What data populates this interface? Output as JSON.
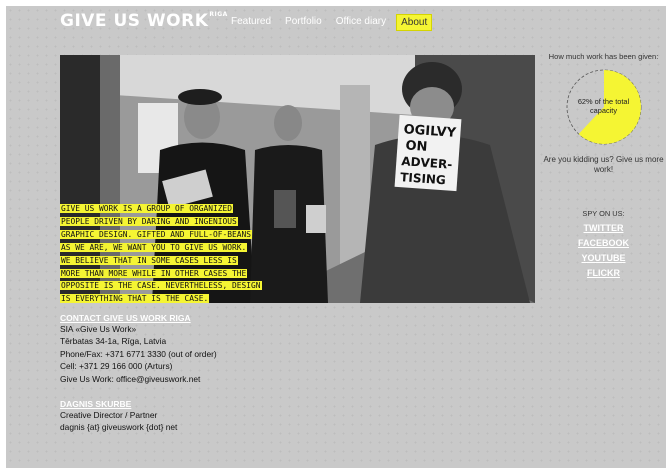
{
  "header": {
    "logo": "GIVE US WORK",
    "logo_sup": "RIGA",
    "nav": [
      {
        "label": "Featured",
        "active": false
      },
      {
        "label": "Portfolio",
        "active": false
      },
      {
        "label": "Office diary",
        "active": false
      },
      {
        "label": "About",
        "active": true
      }
    ]
  },
  "hero": {
    "intro_lines": [
      "GIVE US WORK IS A GROUP OF ORGANIZED",
      "PEOPLE DRIVEN BY DARING AND INGENIOUS",
      "GRAPHIC DESIGN. GIFTED AND FULL-OF-BEANS",
      "AS WE ARE, WE WANT YOU TO GIVE US WORK.",
      "WE BELIEVE THAT IN SOME CASES LESS IS",
      "MORE THAN MORE WHILE IN OTHER CASES THE",
      "OPPOSITE IS THE CASE. NEVERTHELESS, DESIGN",
      "IS EVERYTHING THAT IS THE CASE."
    ],
    "book_title": "OGILVY ON ADVER- TISING"
  },
  "sidebar": {
    "question": "How much work has been given:",
    "gauge_percent": 62,
    "gauge_label": "62% of the total capacity",
    "gauge_color": "#f5f533",
    "prompt": "Are you kidding us? Give us more work!",
    "spy_label": "SPY ON US:",
    "links": [
      "TWITTER",
      "FACEBOOK",
      "YOUTUBE",
      "FLICKR"
    ]
  },
  "contact": {
    "heading": "CONTACT GIVE US WORK RIGA",
    "lines": [
      "SIA «Give Us Work»",
      "Tērbatas 34-1a, Rīga, Latvia",
      "Phone/Fax: +371 6771 3330 (out of order)",
      "Cell: +371 29 166 000 (Arturs)",
      "Give Us Work: office@giveuswork.net"
    ],
    "person_name": "DAGNIS SKURBE",
    "person_role": "Creative Director / Partner",
    "person_email": "dagnis {at} giveuswork {dot} net"
  }
}
